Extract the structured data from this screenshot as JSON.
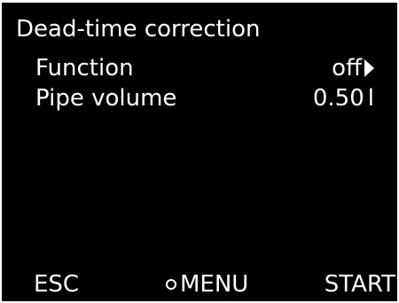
{
  "screen": {
    "title": "Dead-time correction"
  },
  "menu": {
    "items": [
      {
        "label": "Function",
        "value": "off",
        "icon": "arrow-right-icon"
      },
      {
        "label": "Pipe volume",
        "value": "0.50",
        "unit": "l"
      }
    ]
  },
  "softkeys": {
    "esc": "ESC",
    "menu": "MENU",
    "start": "START"
  },
  "colors": {
    "background": "#000000",
    "text": "#ffffff"
  }
}
